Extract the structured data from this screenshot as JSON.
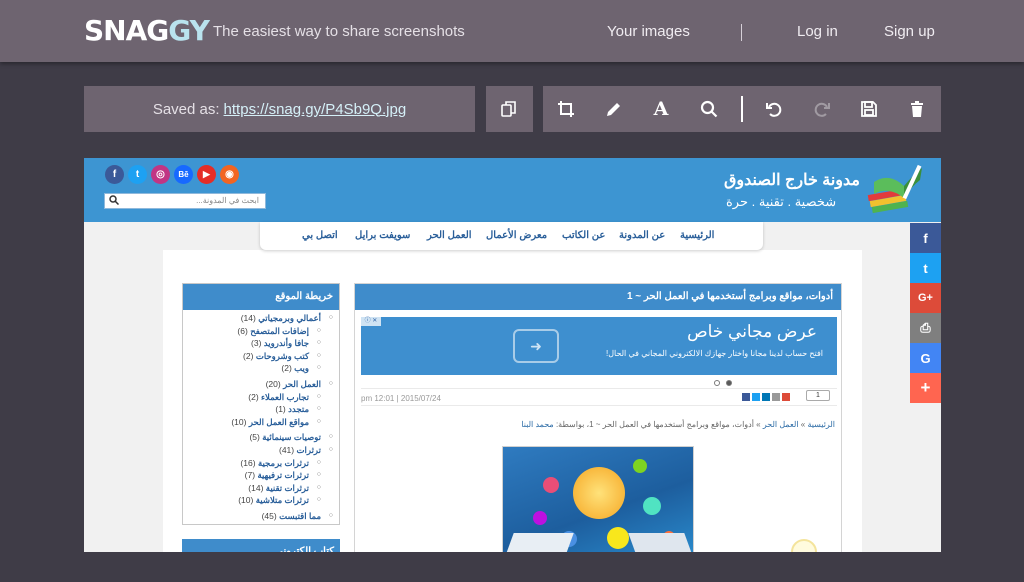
{
  "app": {
    "logo_part1": "SNAG",
    "logo_part2": "GY",
    "tagline": "The easiest way to share screenshots",
    "nav": [
      {
        "label": "Your images"
      },
      {
        "label": "Log in"
      },
      {
        "label": "Sign up"
      }
    ]
  },
  "toolbar": {
    "saved_prefix": "Saved as:",
    "saved_url": "https://snag.gy/P4Sb9Q.jpg",
    "tools": [
      {
        "name": "copy-icon"
      },
      {
        "name": "crop-icon"
      },
      {
        "name": "pencil-icon"
      },
      {
        "name": "text-icon",
        "glyph": "A"
      },
      {
        "name": "zoom-icon"
      },
      {
        "name": "undo-icon"
      },
      {
        "name": "redo-icon",
        "disabled": true
      },
      {
        "name": "save-icon"
      },
      {
        "name": "trash-icon"
      }
    ]
  },
  "screenshot": {
    "header": {
      "title": "مدونة خارج الصندوق",
      "subtitle": "شخصية . تقنية . حرة",
      "search_placeholder": "ابحث في المدونة...",
      "social_icons": [
        {
          "name": "facebook-icon",
          "glyph": "f",
          "color": "#3b5998"
        },
        {
          "name": "twitter-icon",
          "glyph": "t",
          "color": "#1da1f2"
        },
        {
          "name": "instagram-icon",
          "glyph": "◎",
          "color": "#c13584"
        },
        {
          "name": "behance-icon",
          "glyph": "Bē",
          "color": "#1769ff"
        },
        {
          "name": "youtube-icon",
          "glyph": "▶",
          "color": "#e52d27"
        },
        {
          "name": "rss-icon",
          "glyph": "◉",
          "color": "#f26522"
        }
      ]
    },
    "menu": [
      {
        "label": "الرئيسية"
      },
      {
        "label": "عن المدونة"
      },
      {
        "label": "عن الكاتب"
      },
      {
        "label": "معرض الأعمال"
      },
      {
        "label": "العمل الحر"
      },
      {
        "label": "سويفت برايل"
      },
      {
        "label": "اتصل بي"
      }
    ],
    "sidebar": {
      "title": "خريطة الموقع",
      "items": [
        {
          "label": "أعمالي وبرمجياتي",
          "count": "(14)"
        },
        {
          "label": "إضافات المتصفح",
          "count": "(6)",
          "sub": true
        },
        {
          "label": "جافا وأندرويد",
          "count": "(3)",
          "sub": true
        },
        {
          "label": "كتب وشروحات",
          "count": "(2)",
          "sub": true
        },
        {
          "label": "ويب",
          "count": "(2)",
          "sub": true
        },
        {
          "label": "العمل الحر",
          "count": "(20)"
        },
        {
          "label": "تجارب العملاء",
          "count": "(2)",
          "sub": true
        },
        {
          "label": "متجدد",
          "count": "(1)",
          "sub": true
        },
        {
          "label": "مواقع العمل الحر",
          "count": "(10)",
          "sub": true
        },
        {
          "label": "توصيات سينمائية",
          "count": "(5)"
        },
        {
          "label": "ترثرات",
          "count": "(41)"
        },
        {
          "label": "ترثرات برمجية",
          "count": "(16)",
          "sub": true
        },
        {
          "label": "ترثرات ترفيهية",
          "count": "(7)",
          "sub": true
        },
        {
          "label": "ترثرات تقنية",
          "count": "(14)",
          "sub": true
        },
        {
          "label": "ترثرات متلاشية",
          "count": "(10)",
          "sub": true
        },
        {
          "label": "مما اقتبست",
          "count": "(45)"
        }
      ],
      "second_title": "كتاب إلكتروني"
    },
    "post": {
      "title": "أدوات، مواقع وبرامج أستخدمها في العمل الحر ~ 1",
      "ad_title": "عرض مجاني خاص",
      "ad_text": "افتح حساب لدينا مجانا واختار جهازك الالكتروني المجاني في الحال!",
      "ad_badge": "ⓘ ✕",
      "ad_button": "➜",
      "date": "pm 12:01 | 2015/07/24",
      "share_count": "1",
      "breadcrumb_links": [
        "الرئيسية",
        "العمل الحر"
      ],
      "breadcrumb_rest": "» أدوات، مواقع وبرامج أستخدمها في العمل الحر ~ 1، بواسطة: ",
      "author": "محمد البنا"
    },
    "floating_share": [
      {
        "name": "facebook-share-icon",
        "glyph": "f",
        "color": "#3b5998"
      },
      {
        "name": "twitter-share-icon",
        "glyph": "t",
        "color": "#1da1f2"
      },
      {
        "name": "google-plus-share-icon",
        "glyph": "G+",
        "color": "#dd4b39"
      },
      {
        "name": "print-share-icon",
        "glyph": "⎙",
        "color": "#7f7f7f"
      },
      {
        "name": "google-share-icon",
        "glyph": "G",
        "color": "#4285f4"
      },
      {
        "name": "more-share-icon",
        "glyph": "+",
        "color": "#ff6550"
      }
    ]
  }
}
